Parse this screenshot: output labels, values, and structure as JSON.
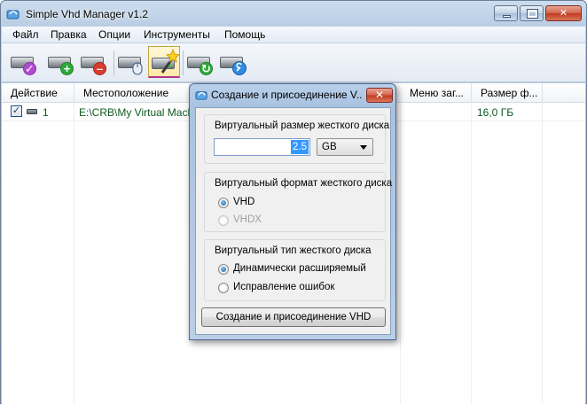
{
  "window": {
    "title": "Simple Vhd Manager v1.2"
  },
  "menu": [
    "Файл",
    "Правка",
    "Опции",
    "Инструменты",
    "Помощь"
  ],
  "toolbar": {
    "buttons": [
      {
        "icon": "disk-check-icon",
        "badge": "✓",
        "color": "#b04bd0"
      },
      {
        "icon": "disk-add-icon",
        "badge": "+",
        "color": "#2eaa3a"
      },
      {
        "icon": "disk-remove-icon",
        "badge": "–",
        "color": "#d93a2e"
      },
      {
        "icon": "disk-mouse-icon",
        "badge": "",
        "color": "#3a7bd0"
      },
      {
        "icon": "disk-magic-wand-icon",
        "badge": "",
        "color": "#e0b020"
      },
      {
        "icon": "disk-refresh-icon",
        "badge": "↻",
        "color": "#2eaa3a"
      },
      {
        "icon": "disk-wrench-icon",
        "badge": "",
        "color": "#2e8be0"
      }
    ]
  },
  "list": {
    "columns": [
      "Действие",
      "Местоположение",
      "Меню заг...",
      "Размер ф..."
    ],
    "rows": [
      {
        "checked": true,
        "number": "1",
        "location": "E:\\CRB\\My Virtual Machines",
        "size": "16,0 ГБ"
      }
    ]
  },
  "dialog": {
    "title": "Создание и присоединение V...",
    "size_group": {
      "label": "Виртуальный размер жесткого диска",
      "value": "2.5",
      "unit": "GB"
    },
    "format_group": {
      "label": "Виртуальный формат жесткого диска",
      "options": [
        {
          "label": "VHD",
          "selected": true,
          "disabled": false
        },
        {
          "label": "VHDX",
          "selected": false,
          "disabled": true
        }
      ]
    },
    "type_group": {
      "label": "Виртуальный тип жесткого диска",
      "options": [
        {
          "label": "Динамически расширяемый",
          "selected": true
        },
        {
          "label": "Исправление ошибок",
          "selected": false
        }
      ]
    },
    "create_button": "Создание и присоединение VHD"
  },
  "colors": {
    "row_text": "#0e5a1e",
    "accent": "#3399ff"
  }
}
